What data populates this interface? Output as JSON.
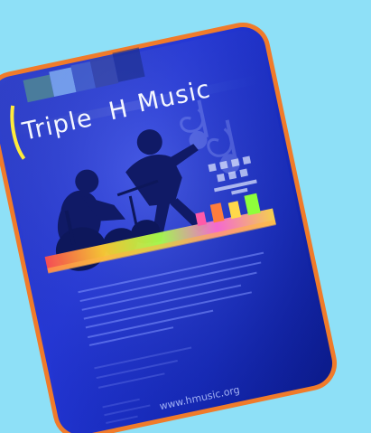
{
  "poster": {
    "title_part_1": "Triple",
    "title_part_2": "H",
    "title_part_3": "Music",
    "website": "www.hmusic.org"
  },
  "colors": {
    "background": "#8ee0f7",
    "border": "#f07b2a",
    "poster_blue": "#2233cc",
    "poster_dark": "#0b1590"
  }
}
